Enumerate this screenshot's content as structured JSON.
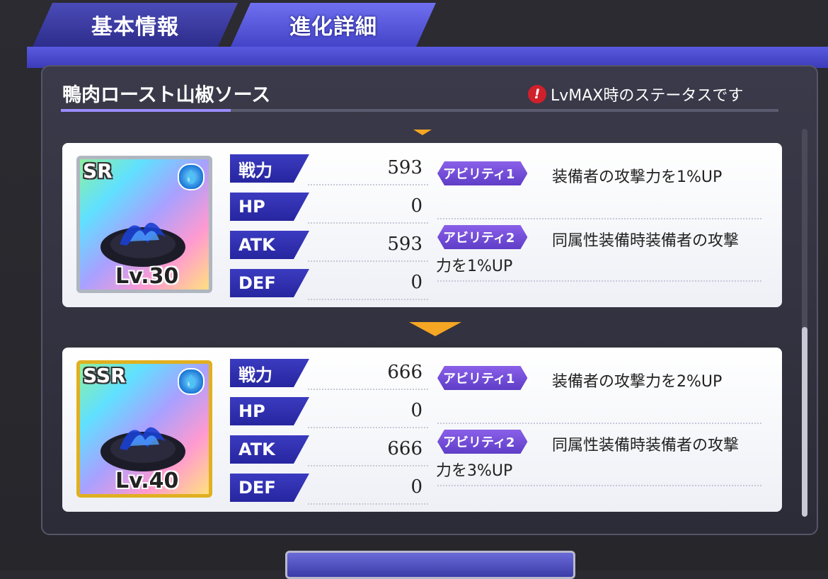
{
  "tabs": [
    {
      "label": "基本情報",
      "active": false
    },
    {
      "label": "進化詳細",
      "active": true
    }
  ],
  "item_name": "鴨肉ロースト山椒ソース",
  "note": {
    "icon": "warning-icon",
    "text": "LvMAX時のステータスです"
  },
  "colors": {
    "accent": "#4444c8",
    "arrow": "#f5a623",
    "ability_tag": "#6f48d6"
  },
  "cards": [
    {
      "rarity": "SR",
      "element_icon": "water-drop-icon",
      "level": "Lv.30",
      "stats": [
        {
          "label": "戦力",
          "value": "593"
        },
        {
          "label": "HP",
          "value": "0"
        },
        {
          "label": "ATK",
          "value": "593"
        },
        {
          "label": "DEF",
          "value": "0"
        }
      ],
      "abilities": [
        {
          "tag": "アビリティ1",
          "line1": "装備者の攻撃力を1%UP",
          "line2": ""
        },
        {
          "tag": "アビリティ2",
          "line1": "同属性装備時装備者の攻撃",
          "line2": "力を1%UP"
        }
      ]
    },
    {
      "rarity": "SSR",
      "element_icon": "water-drop-icon",
      "level": "Lv.40",
      "stats": [
        {
          "label": "戦力",
          "value": "666"
        },
        {
          "label": "HP",
          "value": "0"
        },
        {
          "label": "ATK",
          "value": "666"
        },
        {
          "label": "DEF",
          "value": "0"
        }
      ],
      "abilities": [
        {
          "tag": "アビリティ1",
          "line1": "装備者の攻撃力を2%UP",
          "line2": ""
        },
        {
          "tag": "アビリティ2",
          "line1": "同属性装備時装備者の攻撃",
          "line2": "力を3%UP"
        }
      ]
    }
  ]
}
